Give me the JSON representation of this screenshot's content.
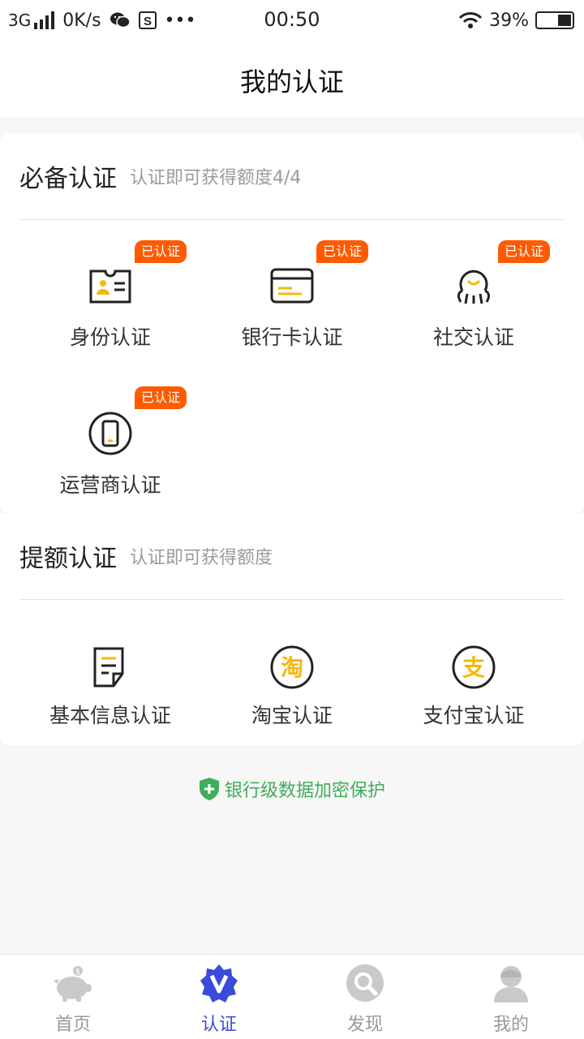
{
  "status_bar": {
    "network": "3G",
    "speed": "0K/s",
    "more": "•••",
    "time": "00:50",
    "battery": "39%",
    "battery_level": 0.39
  },
  "page_title": "我的认证",
  "required_section": {
    "title": "必备认证",
    "subtitle": "认证即可获得额度4/4",
    "items": [
      {
        "label": "身份认证",
        "badge": "已认证",
        "icon": "id-card-icon"
      },
      {
        "label": "银行卡认证",
        "badge": "已认证",
        "icon": "bank-card-icon"
      },
      {
        "label": "社交认证",
        "badge": "已认证",
        "icon": "social-icon"
      },
      {
        "label": "运营商认证",
        "badge": "已认证",
        "icon": "mobile-carrier-icon"
      }
    ]
  },
  "credit_section": {
    "title": "提额认证",
    "subtitle": "认证即可获得额度",
    "items": [
      {
        "label": "基本信息认证",
        "icon": "document-icon"
      },
      {
        "label": "淘宝认证",
        "icon": "taobao-icon",
        "glyph": "淘"
      },
      {
        "label": "支付宝认证",
        "icon": "alipay-icon",
        "glyph": "支"
      }
    ]
  },
  "security_note": "银行级数据加密保护",
  "tabs": [
    {
      "label": "首页",
      "icon": "piggy-bank-icon",
      "active": false
    },
    {
      "label": "认证",
      "icon": "verify-badge-icon",
      "active": true
    },
    {
      "label": "发现",
      "icon": "discover-icon",
      "active": false
    },
    {
      "label": "我的",
      "icon": "user-icon",
      "active": false
    }
  ],
  "colors": {
    "accent_orange": "#ff5a00",
    "icon_yellow": "#f5b80c",
    "tab_active": "#3b4bd9",
    "secure_green": "#3dae5a"
  }
}
